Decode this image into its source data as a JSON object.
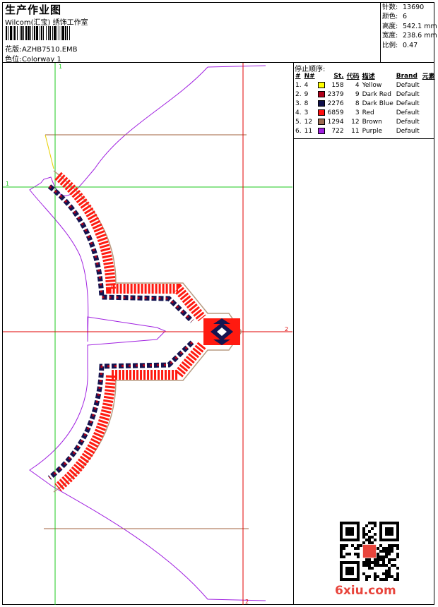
{
  "header": {
    "title": "生产作业图",
    "company": "Wilcom(汇宝) 绣饰工作室",
    "design_label": "花版:",
    "design_value": "AZHB7510.EMB",
    "colorway_label": "色位:",
    "colorway_value": "Colorway 1"
  },
  "stats": [
    {
      "label": "针数:",
      "value": "13690"
    },
    {
      "label": "颜色:",
      "value": "6"
    },
    {
      "label": "高度:",
      "value": "542.1 mm"
    },
    {
      "label": "宽度:",
      "value": "238.6 mm"
    },
    {
      "label": "比例:",
      "value": "0.47"
    }
  ],
  "stop_sequence": {
    "title": "停止顺序:",
    "headers": {
      "num": "#",
      "n": "N#",
      "st": "St.",
      "code": "代码",
      "desc": "描述",
      "brand": "Brand",
      "elem": "元素"
    },
    "rows": [
      {
        "idx": "1.",
        "n": "4",
        "color": "#ffff00",
        "st": "158",
        "code": "4",
        "desc": "Yellow",
        "brand": "Default"
      },
      {
        "idx": "2.",
        "n": "9",
        "color": "#b0001a",
        "st": "2379",
        "code": "9",
        "desc": "Dark Red",
        "brand": "Default"
      },
      {
        "idx": "3.",
        "n": "8",
        "color": "#10104a",
        "st": "2276",
        "code": "8",
        "desc": "Dark Blue",
        "brand": "Default"
      },
      {
        "idx": "4.",
        "n": "3",
        "color": "#ff1010",
        "st": "6859",
        "code": "3",
        "desc": "Red",
        "brand": "Default"
      },
      {
        "idx": "5.",
        "n": "12",
        "color": "#9a6a50",
        "st": "1294",
        "code": "12",
        "desc": "Brown",
        "brand": "Default"
      },
      {
        "idx": "6.",
        "n": "11",
        "color": "#a020e0",
        "st": "722",
        "code": "11",
        "desc": "Purple",
        "brand": "Default"
      }
    ]
  },
  "canvas": {
    "guide_labels": {
      "top_v": "1",
      "left_h": "1",
      "right_h": "2",
      "bottom_v": "2"
    }
  },
  "watermark": "6xiu.com"
}
